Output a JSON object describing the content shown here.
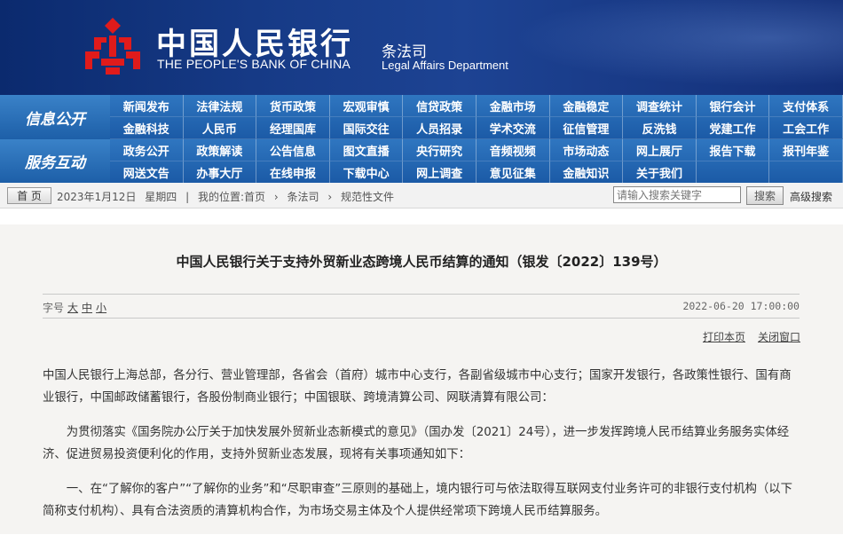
{
  "header": {
    "bank_cn": "中国人民银行",
    "bank_en": "THE PEOPLE'S BANK OF CHINA",
    "dept_cn": "条法司",
    "dept_en": "Legal Affairs Department",
    "brand_color": "#1d4393",
    "emblem_color": "#e01b1b"
  },
  "nav": {
    "group1_label": "信息公开",
    "group1_items": [
      "新闻发布",
      "法律法规",
      "货币政策",
      "宏观审慎",
      "信贷政策",
      "金融市场",
      "金融稳定",
      "调查统计",
      "银行会计",
      "支付体系",
      "金融科技",
      "人民币",
      "经理国库",
      "国际交往",
      "人员招录",
      "学术交流",
      "征信管理",
      "反洗钱",
      "党建工作",
      "工会工作"
    ],
    "group2_label": "服务互动",
    "group2_items": [
      "政务公开",
      "政策解读",
      "公告信息",
      "图文直播",
      "央行研究",
      "音频视频",
      "市场动态",
      "网上展厅",
      "报告下载",
      "报刊年鉴",
      "网送文告",
      "办事大厅",
      "在线申报",
      "下载中心",
      "网上调查",
      "意见征集",
      "金融知识",
      "关于我们",
      "",
      ""
    ]
  },
  "breadcrumb": {
    "home": "首 页",
    "date": "2023年1月12日",
    "weekday": "星期四",
    "location_label": "我的位置:",
    "items": [
      "首页",
      "条法司",
      "规范性文件"
    ],
    "search_placeholder": "请输入搜索关键字",
    "search_button": "搜索",
    "advanced": "高级搜索"
  },
  "article": {
    "title": "中国人民银行关于支持外贸新业态跨境人民币结算的通知（银发〔2022〕139号）",
    "size_label": "字号",
    "size_large": "大",
    "size_medium": "中",
    "size_small": "小",
    "datetime": "2022-06-20 17:00:00",
    "print": "打印本页",
    "close": "关闭窗口",
    "paragraphs": [
      "中国人民银行上海总部，各分行、营业管理部，各省会（首府）城市中心支行，各副省级城市中心支行；国家开发银行，各政策性银行、国有商业银行，中国邮政储蓄银行，各股份制商业银行；中国银联、跨境清算公司、网联清算有限公司：",
      "为贯彻落实《国务院办公厅关于加快发展外贸新业态新模式的意见》（国办发〔2021〕24号），进一步发挥跨境人民币结算业务服务实体经济、促进贸易投资便利化的作用，支持外贸新业态发展，现将有关事项通知如下：",
      "一、在“了解你的客户”“了解你的业务”和“尽职审查”三原则的基础上，境内银行可与依法取得互联网支付业务许可的非银行支付机构（以下简称支付机构）、具有合法资质的清算机构合作，为市场交易主体及个人提供经常项下跨境人民币结算服务。"
    ]
  }
}
